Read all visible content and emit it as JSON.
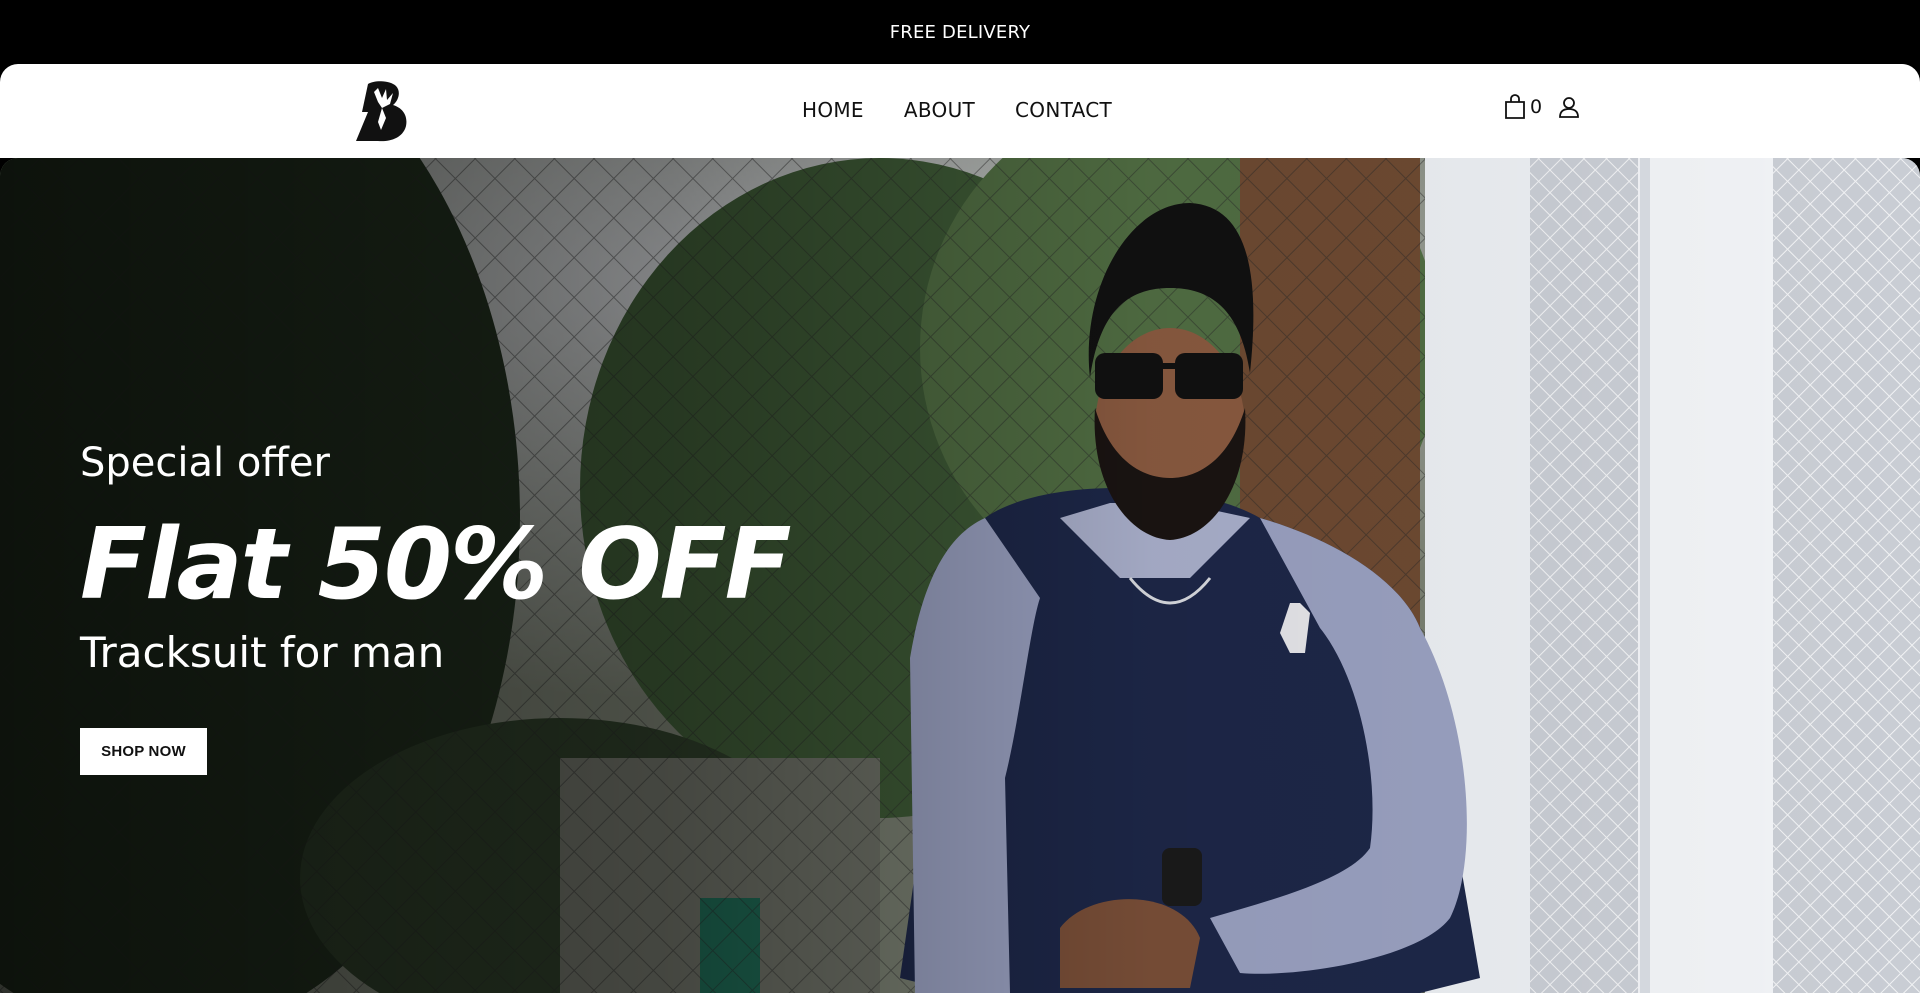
{
  "announcement": {
    "text": "FREE DELIVERY"
  },
  "header": {
    "logo_icon": "stag-b-logo-icon",
    "nav": [
      {
        "label": "HOME"
      },
      {
        "label": "ABOUT"
      },
      {
        "label": "CONTACT"
      }
    ],
    "cart": {
      "icon": "shopping-bag-icon",
      "count": "0"
    },
    "account": {
      "icon": "user-icon"
    }
  },
  "hero": {
    "eyebrow": "Special offer",
    "headline": "Flat 50% OFF",
    "subline": "Tracksuit for man",
    "cta_label": "SHOP NOW",
    "image": "man-in-navy-sweatshirt-by-chain-link-fence"
  },
  "colors": {
    "announce_bg": "#000000",
    "header_bg": "#ffffff",
    "shirt_navy": "#1d2748",
    "shirt_sleeve": "#9aa1c1",
    "cta_bg": "#ffffff"
  }
}
